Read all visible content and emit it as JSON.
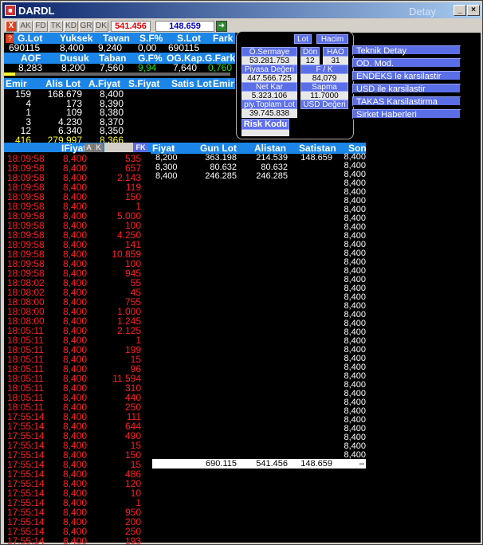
{
  "window": {
    "title": "DARDL",
    "subtitle": "Detay"
  },
  "toolbar": {
    "x_label": "X",
    "buttons": [
      "AK",
      "FD",
      "TK",
      "KD",
      "GR",
      "DK"
    ],
    "value_red": "541.456",
    "value_blue": "148.659"
  },
  "summary": {
    "headers1": [
      "G.Lot",
      "Yuksek",
      "Tavan",
      "S.F%",
      "S.Lot",
      "Fark"
    ],
    "values1": [
      "690115",
      "8,400",
      "9,240",
      "0,00",
      "690115",
      ""
    ],
    "headers2": [
      "AOF",
      "Dusuk",
      "Taban",
      "G.F%",
      "OG.Kap.",
      "G.Fark"
    ],
    "values2": [
      "8,283",
      "8,200",
      "7,560",
      "9,94",
      "7,640",
      "0,760"
    ],
    "progress": 0.05
  },
  "orders": {
    "headers": [
      "Emir",
      "Alis Lot",
      "A.Fiyat",
      "S.Fiyat",
      "Satis Lot",
      "Emir"
    ],
    "rows": [
      [
        "159",
        "168.679",
        "8,400"
      ],
      [
        "4",
        "173",
        "8,390"
      ],
      [
        "1",
        "109",
        "8,380"
      ],
      [
        "3",
        "4.230",
        "8,370"
      ],
      [
        "12",
        "6.340",
        "8,350"
      ],
      [
        "416",
        "279.997",
        "8,366"
      ]
    ]
  },
  "panel": {
    "lot": "Lot",
    "hacim": "Hacim",
    "sermaye_label": "Ö.Sermaye",
    "sermaye_value": "53.281.753",
    "don_label": "Dön",
    "don_value": "12",
    "hao_label": "HAO",
    "hao_value": "31",
    "piyasa_label": "Piyasa Değeri",
    "piyasa_value": "447.566.725",
    "fk_label": "F / K",
    "fk_value": "84,079",
    "netkar_label": "Net Kar",
    "netkar_value": "5.323.106",
    "sapma_label": "Sapma",
    "sapma_value": "11.7000",
    "toplam_label": "piy.Toplam Lot",
    "toplam_value": "39.745.838",
    "usd_label": "USD Değeri",
    "risk_label": "Risk Kodu"
  },
  "menu": [
    "Teknik Detay",
    "OD. Mod.",
    "ENDEKS le karsilastir",
    "USD ile karsilastir",
    "TAKAS Karsilastirma",
    "Sirket Haberleri"
  ],
  "trades_header": {
    "fiyat": "IFiyat",
    "a": "A",
    "k": "K",
    "fk": "FK"
  },
  "depth_header": [
    "Fiyat",
    "Gun Lot",
    "Alistan",
    "Satistan",
    "Son"
  ],
  "depth_rows": [
    [
      "8,200",
      "363.198",
      "214.539",
      "148.659"
    ],
    [
      "8,300",
      "80.632",
      "80.632",
      ""
    ],
    [
      "8,400",
      "246.285",
      "246.285",
      ""
    ]
  ],
  "depth_totals": [
    "690.115",
    "541.456",
    "148.659",
    "–"
  ],
  "son_value": "8,400",
  "son_count": 35,
  "trades": [
    [
      "18:09:58",
      "8,400",
      "535"
    ],
    [
      "18:09:58",
      "8,400",
      "657"
    ],
    [
      "18:09:58",
      "8,400",
      "2.143"
    ],
    [
      "18:09:58",
      "8,400",
      "119"
    ],
    [
      "18:09:58",
      "8,400",
      "150"
    ],
    [
      "18:09:58",
      "8,400",
      "1"
    ],
    [
      "18:09:58",
      "8,400",
      "5.000"
    ],
    [
      "18:09:58",
      "8,400",
      "100"
    ],
    [
      "18:09:58",
      "8,400",
      "4.250"
    ],
    [
      "18:09:58",
      "8,400",
      "141"
    ],
    [
      "18:09:58",
      "8,400",
      "10.859"
    ],
    [
      "18:09:58",
      "8,400",
      "100"
    ],
    [
      "18:09:58",
      "8,400",
      "945"
    ],
    [
      "18:08:02",
      "8,400",
      "55"
    ],
    [
      "18:08:02",
      "8,400",
      "45"
    ],
    [
      "18:08:00",
      "8,400",
      "755"
    ],
    [
      "18:08:00",
      "8,400",
      "1.000"
    ],
    [
      "18:08:00",
      "8,400",
      "1.245"
    ],
    [
      "18:05:11",
      "8,400",
      "2.125"
    ],
    [
      "18:05:11",
      "8,400",
      "1"
    ],
    [
      "18:05:11",
      "8,400",
      "199"
    ],
    [
      "18:05:11",
      "8,400",
      "15"
    ],
    [
      "18:05:11",
      "8,400",
      "96"
    ],
    [
      "18:05:11",
      "8,400",
      "11.594"
    ],
    [
      "18:05:11",
      "8,400",
      "310"
    ],
    [
      "18:05:11",
      "8,400",
      "440"
    ],
    [
      "18:05:11",
      "8,400",
      "250"
    ],
    [
      "17:55:14",
      "8,400",
      "111"
    ],
    [
      "17:55:14",
      "8,400",
      "644"
    ],
    [
      "17:55:14",
      "8,400",
      "490"
    ],
    [
      "17:55:14",
      "8,400",
      "15"
    ],
    [
      "17:55:14",
      "8,400",
      "150"
    ],
    [
      "17:55:14",
      "8,400",
      "15"
    ],
    [
      "17:55:14",
      "8,400",
      "486"
    ],
    [
      "17:55:14",
      "8,400",
      "120"
    ],
    [
      "17:55:14",
      "8,400",
      "10"
    ],
    [
      "17:55:14",
      "8,400",
      "1"
    ],
    [
      "17:55:14",
      "8,400",
      "950"
    ],
    [
      "17:55:14",
      "8,400",
      "200"
    ],
    [
      "17:55:14",
      "8,400",
      "250"
    ],
    [
      "17:55:14",
      "8,400",
      "193"
    ]
  ]
}
